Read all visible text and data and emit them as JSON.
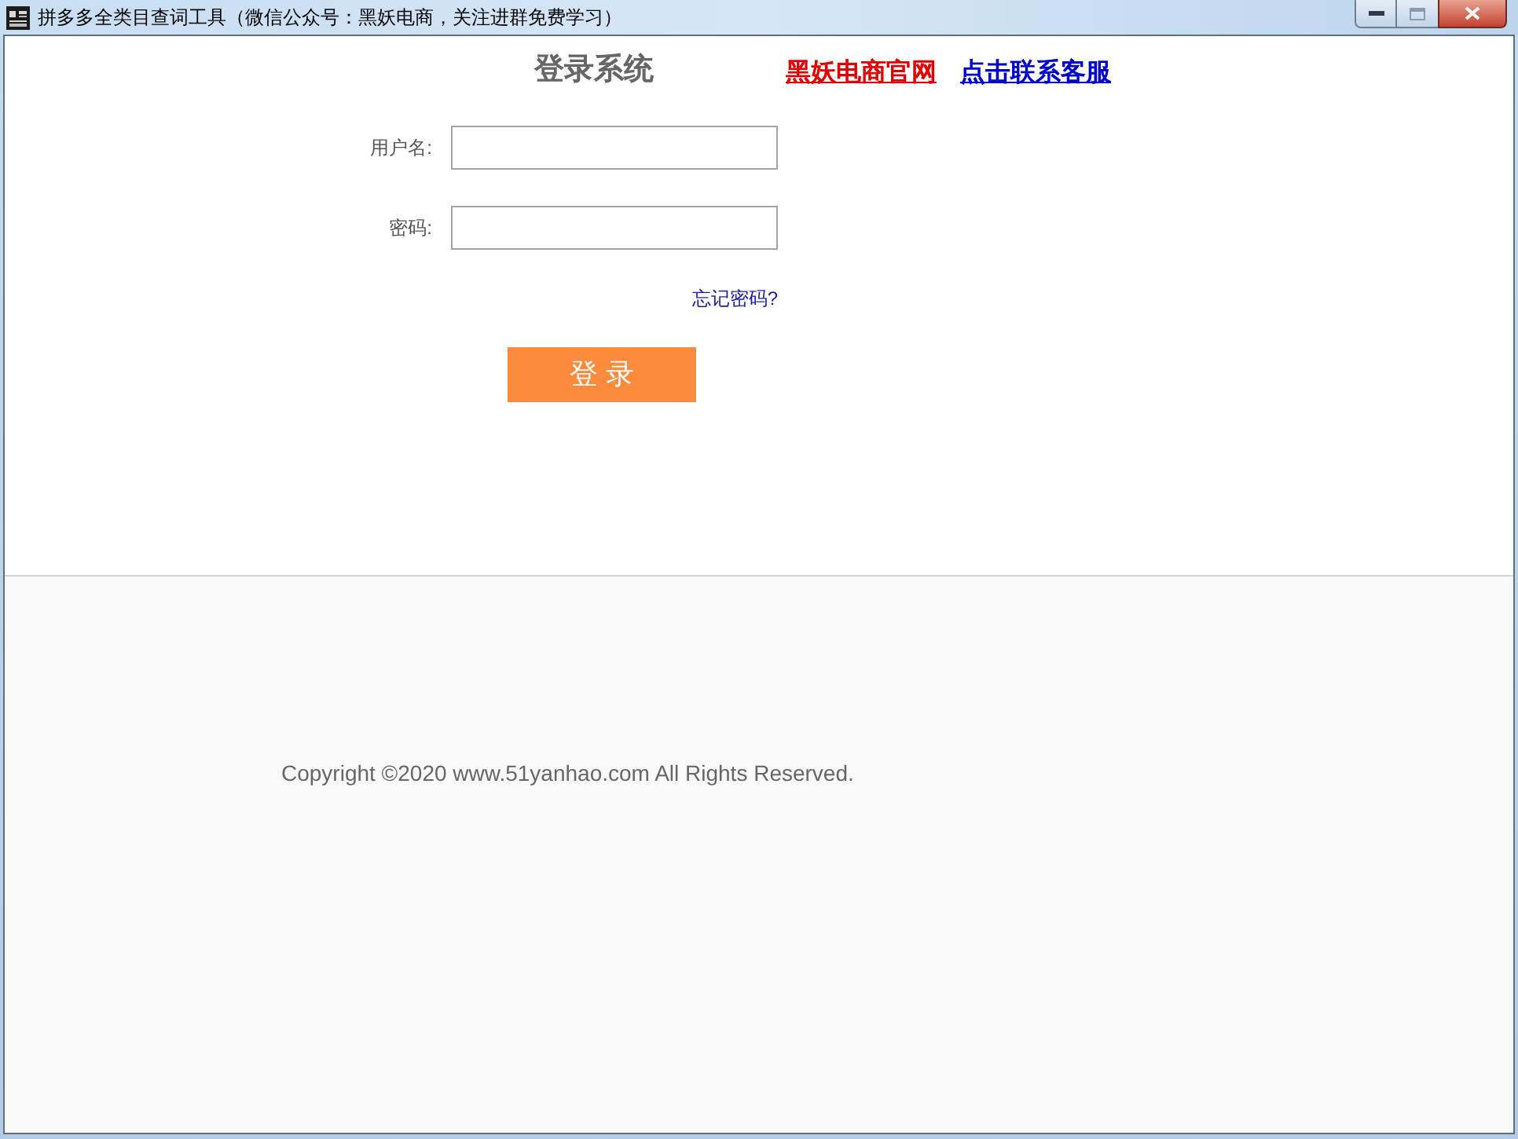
{
  "window": {
    "title": "拼多多全类目查词工具（微信公众号：黑妖电商，关注进群免费学习）"
  },
  "header": {
    "heading": "登录系统",
    "links": [
      {
        "text": "黑妖电商官网",
        "color": "#e00000"
      },
      {
        "text": "点击联系客服",
        "color": "#0000cc"
      }
    ]
  },
  "form": {
    "fields": [
      {
        "label": "用户名:"
      },
      {
        "label": "密码:"
      }
    ],
    "forgot_link": "忘记密码?",
    "submit": "登 录"
  },
  "footer": {
    "copyright": "Copyright ©2020 www.51yanhao.com All Rights Reserved."
  }
}
